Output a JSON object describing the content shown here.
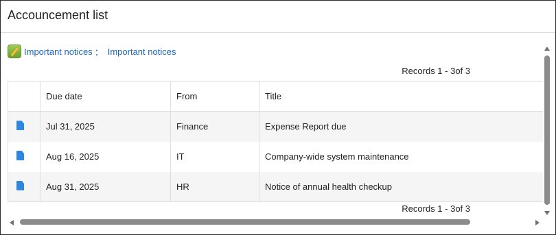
{
  "panel": {
    "title": "Accouncement list"
  },
  "notice": {
    "link1": "Important notices",
    "separator": "：",
    "link2": "Important notices",
    "icon": "pencil-icon"
  },
  "records": {
    "top": "Records 1 - 3of 3",
    "bottom": "Records 1 - 3of 3"
  },
  "table": {
    "columns": [
      "",
      "Due date",
      "From",
      "Title"
    ],
    "rows": [
      {
        "icon": "document-icon",
        "due": "Jul 31, 2025",
        "from": "Finance",
        "title": "Expense Report due"
      },
      {
        "icon": "document-icon",
        "due": "Aug 16, 2025",
        "from": "IT",
        "title": "Company-wide system maintenance"
      },
      {
        "icon": "document-icon",
        "due": "Aug 31, 2025",
        "from": "HR",
        "title": "Notice of annual health checkup"
      }
    ]
  },
  "colors": {
    "link": "#1a66c2",
    "doc_icon": "#2f86e0",
    "row_alt": "#f5f5f5",
    "border": "#2b2b2b"
  }
}
